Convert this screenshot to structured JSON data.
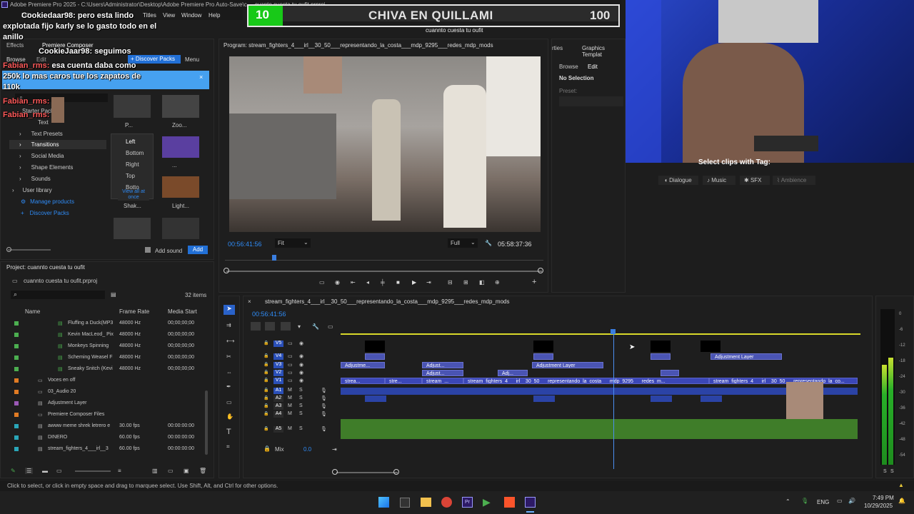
{
  "window": {
    "title": "Adobe Premiere Pro 2025 - C:\\Users\\Administrator\\Desktop\\Adobe Premiere Pro Auto-Save\\c ... cuanto cuesta tu oufit.prproj"
  },
  "menu": [
    "Edit",
    "Titles",
    "View",
    "Window",
    "Help"
  ],
  "overlay": {
    "score_left": "10",
    "banner_title": "CHIVA EN QUILLAMI",
    "score_right": "100",
    "subtitle": "cuannto cuesta tu oufit"
  },
  "chat": [
    {
      "user": "Cookiedaar98:",
      "text": "pero esta lindo"
    },
    {
      "user": "",
      "text": "explotada fijo karly se lo gasto todo en el"
    },
    {
      "user": "",
      "text": "anillo"
    },
    {
      "user": "CookieJaar98:",
      "text": "seguimos"
    },
    {
      "user": "Fabian_rms:",
      "text": "esa cuenta daba como"
    },
    {
      "user": "",
      "text": "250k lo mas caros tue los zapatos de"
    },
    {
      "user": "",
      "text": "110k"
    },
    {
      "user": "Fabian_rms:",
      "text": ""
    },
    {
      "user": "Fabian_rms:",
      "text": ""
    }
  ],
  "effects": {
    "tabs": [
      "Effects",
      "Premiere Composer"
    ],
    "subtabs": [
      "Browse",
      "Edit"
    ],
    "discover_btn": "+ Discover Packs",
    "menu_label": "Menu",
    "tree": [
      {
        "label": "Starter Pack"
      },
      {
        "label": "Text"
      },
      {
        "label": "Text Presets"
      },
      {
        "label": "Transitions"
      },
      {
        "label": "Social Media"
      },
      {
        "label": "Shape Elements"
      },
      {
        "label": "Sounds"
      },
      {
        "label": "User library"
      },
      {
        "label": "Manage products"
      },
      {
        "label": "Discover Packs"
      }
    ],
    "dropdown": [
      "Left",
      "Bottom",
      "Right",
      "Top",
      "Botto"
    ],
    "view_all": "View all at once",
    "thumbs": [
      "P...",
      "Zoo...",
      "...",
      "Shak...",
      "Light..."
    ],
    "add_sound": "Add sound",
    "add_btn": "Add"
  },
  "program": {
    "title": "Program: stream_fighters_4___irl__30_50___representando_la_costa___mdp_9295___redes_mdp_mods",
    "timecode": "00:56:41:56",
    "fit": "Fit",
    "full": "Full",
    "duration": "05:58:37:36"
  },
  "right_panel": {
    "tabs": [
      "rties",
      "Graphics Templat"
    ],
    "subtabs": [
      "Browse",
      "Edit"
    ],
    "no_selection": "No Selection",
    "preset": "Preset:",
    "select_clips": "Select clips with Tag:",
    "tags": [
      "Dialogue",
      "Music",
      "SFX",
      "Ambience"
    ]
  },
  "project": {
    "title": "Project: cuannto cuesta tu oufit",
    "file": "cuannto cuesta tu oufit.prproj",
    "items_count": "32 items",
    "columns": [
      "Name",
      "Frame Rate",
      "Media Start"
    ],
    "rows": [
      {
        "name": "Fluffing a Duck(MP3",
        "rate": "48000 Hz",
        "start": "00;00;00;00",
        "color": "#4caf50"
      },
      {
        "name": "Kevin MacLeod_ Pix",
        "rate": "48000 Hz",
        "start": "00;00;00;00",
        "color": "#4caf50"
      },
      {
        "name": "Monkeys Spinning",
        "rate": "48000 Hz",
        "start": "00;00;00;00",
        "color": "#4caf50"
      },
      {
        "name": "Scheming Weasel F",
        "rate": "48000 Hz",
        "start": "00;00;00;00",
        "color": "#4caf50"
      },
      {
        "name": "Sneaky Snitch (Kevi",
        "rate": "48000 Hz",
        "start": "00;00;00;00",
        "color": "#4caf50"
      },
      {
        "name": "Voces en off",
        "rate": "",
        "start": "",
        "color": "#e07b24"
      },
      {
        "name": "03_Audio 20",
        "rate": "",
        "start": "",
        "color": "#e07b24"
      },
      {
        "name": "Adjustment Layer",
        "rate": "",
        "start": "",
        "color": "#9b59b6"
      },
      {
        "name": "Premiere Composer Files",
        "rate": "",
        "start": "",
        "color": "#e07b24"
      },
      {
        "name": "awww meme shrek letrero e",
        "rate": "30.00 fps",
        "start": "00:00:00:00",
        "color": "#2aa6b8"
      },
      {
        "name": "DINERO",
        "rate": "60.00 fps",
        "start": "00:00:00:00",
        "color": "#2aa6b8"
      },
      {
        "name": "stream_fighters_4___irl__3",
        "rate": "60.00 fps",
        "start": "00:00:00:00",
        "color": "#2aa6b8"
      }
    ]
  },
  "timeline": {
    "tab": "stream_fighters_4___irl__30_50___representando_la_costa___mdp_9295___redes_mdp_mods",
    "timecode": "00:56:41:56",
    "tracks_v": [
      "V5",
      "V4",
      "V3",
      "V2",
      "V1"
    ],
    "tracks_a": [
      "A1",
      "A2",
      "A3",
      "A4",
      "A5"
    ],
    "mix": "Mix",
    "mix_val": "0.0",
    "clip_labels": {
      "adj1": "Adjustme...",
      "adj2": "Adjust...",
      "adj3": "Adjust...",
      "adj4": "Adj...",
      "adj5": "Adjustment Layer",
      "adj6": "Adjustment Layer",
      "v1a": "strea...",
      "v1b": "stre...",
      "v1c": "stream_...",
      "v1d": "stream_fighters_4___irl__30_50___representando_la_costa___mdp_9295___redes_m...",
      "v1e": "stream_fighters_4___irl__30_50___representando_la_co..."
    },
    "fx": "fx"
  },
  "meter": [
    "0",
    "-6",
    "-12",
    "-18",
    "-24",
    "-30",
    "-36",
    "-42",
    "-48",
    "-54"
  ],
  "meter_s": [
    "S",
    "S"
  ],
  "status": "Click to select, or click in empty space and drag to marquee select. Use Shift, Alt, and Ctrl for other options.",
  "taskbar": {
    "lang": "ENG",
    "time": "7:49 PM",
    "date": "10/29/2025"
  }
}
